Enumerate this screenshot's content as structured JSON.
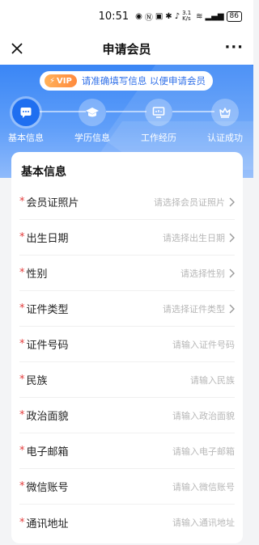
{
  "status_bar": {
    "time": "10:51",
    "speed": "3.1 K/s",
    "battery": "86"
  },
  "nav": {
    "title": "申请会员",
    "more": "···"
  },
  "tip": {
    "badge": "VIP",
    "text": "请准确填写信息 以便申请会员"
  },
  "steps": [
    {
      "label": "基本信息",
      "icon": "chat-icon",
      "active": true
    },
    {
      "label": "学历信息",
      "icon": "graduation-cap-icon",
      "active": false
    },
    {
      "label": "工作经历",
      "icon": "monitor-icon",
      "active": false
    },
    {
      "label": "认证成功",
      "icon": "crown-icon",
      "active": false
    }
  ],
  "form": {
    "section_title": "基本信息",
    "fields": [
      {
        "label": "会员证照片",
        "value": "请选择会员证照片",
        "chevron": true
      },
      {
        "label": "出生日期",
        "value": "请选择出生日期",
        "chevron": true
      },
      {
        "label": "性别",
        "value": "请选择性别",
        "chevron": true
      },
      {
        "label": "证件类型",
        "value": "请选择证件类型",
        "chevron": true
      },
      {
        "label": "证件号码",
        "value": "请输入证件号码",
        "chevron": false
      },
      {
        "label": "民族",
        "value": "请输入民族",
        "chevron": false
      },
      {
        "label": "政治面貌",
        "value": "请输入政治面貌",
        "chevron": false
      },
      {
        "label": "电子邮箱",
        "value": "请输入电子邮箱",
        "chevron": false
      },
      {
        "label": "微信账号",
        "value": "请输入微信账号",
        "chevron": false
      },
      {
        "label": "通讯地址",
        "value": "请输入通讯地址",
        "chevron": false
      }
    ]
  },
  "colors": {
    "primary": "#3a86f5",
    "required": "#e23b3b",
    "placeholder": "#b7b7b7",
    "vip": "#ff8a3d"
  }
}
